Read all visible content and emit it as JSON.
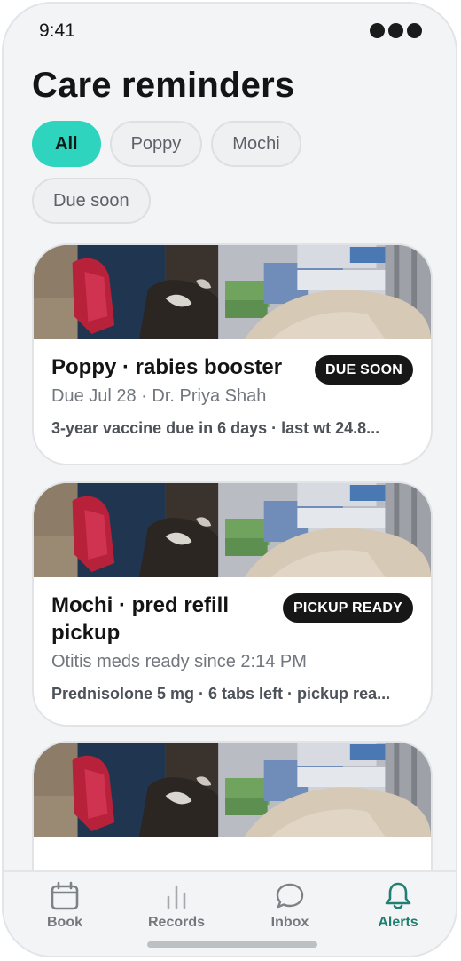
{
  "status_bar": {
    "time": "9:41"
  },
  "page": {
    "title": "Care reminders"
  },
  "filters": [
    {
      "label": "All",
      "active": true
    },
    {
      "label": "Poppy",
      "active": false
    },
    {
      "label": "Mochi",
      "active": false
    },
    {
      "label": "Due soon",
      "active": false
    }
  ],
  "reminders": [
    {
      "title": "Poppy · rabies booster",
      "badge": "DUE SOON",
      "subtitle": "Due Jul 28 · Dr. Priya Shah",
      "detail": "3-year vaccine due in 6 days · last wt 24.8..."
    },
    {
      "title": "Mochi · pred refill pickup",
      "badge": "PICKUP READY",
      "subtitle": "Otitis meds ready since 2:14 PM",
      "detail": "Prednisolone 5 mg · 6 tabs left · pickup rea..."
    }
  ],
  "tabbar": {
    "items": [
      {
        "label": "Book",
        "icon": "calendar-icon",
        "active": false
      },
      {
        "label": "Records",
        "icon": "bar-chart-icon",
        "active": false
      },
      {
        "label": "Inbox",
        "icon": "chat-bubble-icon",
        "active": false
      },
      {
        "label": "Alerts",
        "icon": "bell-icon",
        "active": true
      }
    ]
  },
  "colors": {
    "accent": "#2fd4bf",
    "active_tab": "#1f7f73",
    "badge_bg": "#171717"
  }
}
